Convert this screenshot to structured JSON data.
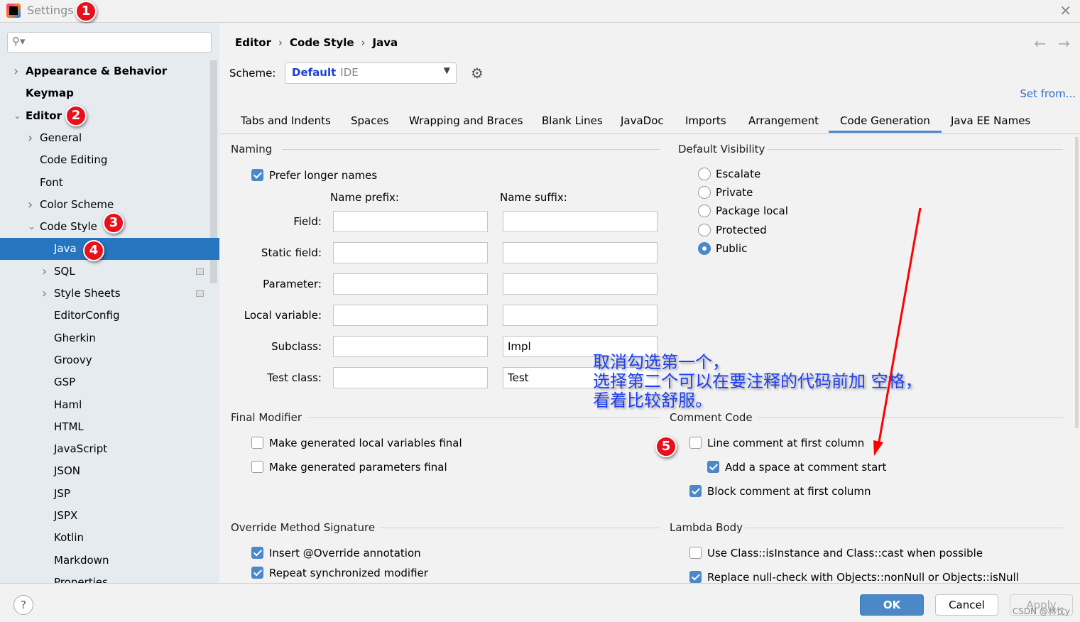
{
  "window": {
    "title": "Settings",
    "close_icon": "close-icon"
  },
  "annotations": {
    "b1": "1",
    "b2": "2",
    "b3": "3",
    "b4": "4",
    "b5": "5",
    "note": "取消勾选第一个，\n选择第二个可以在要注释的代码前加 空格，\n看着比较舒服。",
    "arrow_color": "#ff0000"
  },
  "sidebar": {
    "search_placeholder": "",
    "items": [
      {
        "label": "Appearance & Behavior"
      },
      {
        "label": "Keymap"
      },
      {
        "label": "Editor"
      },
      {
        "label": "General"
      },
      {
        "label": "Code Editing"
      },
      {
        "label": "Font"
      },
      {
        "label": "Color Scheme"
      },
      {
        "label": "Code Style"
      },
      {
        "label": "Java"
      },
      {
        "label": "SQL"
      },
      {
        "label": "Style Sheets"
      },
      {
        "label": "EditorConfig"
      },
      {
        "label": "Gherkin"
      },
      {
        "label": "Groovy"
      },
      {
        "label": "GSP"
      },
      {
        "label": "Haml"
      },
      {
        "label": "HTML"
      },
      {
        "label": "JavaScript"
      },
      {
        "label": "JSON"
      },
      {
        "label": "JSP"
      },
      {
        "label": "JSPX"
      },
      {
        "label": "Kotlin"
      },
      {
        "label": "Markdown"
      },
      {
        "label": "Properties"
      }
    ]
  },
  "breadcrumb": [
    "Editor",
    "Code Style",
    "Java"
  ],
  "scheme": {
    "label": "Scheme:",
    "value": "Default",
    "sub": "IDE",
    "set_from": "Set from..."
  },
  "tabs": [
    "Tabs and Indents",
    "Spaces",
    "Wrapping and Braces",
    "Blank Lines",
    "JavaDoc",
    "Imports",
    "Arrangement",
    "Code Generation",
    "Java EE Names"
  ],
  "active_tab": "Code Generation",
  "naming": {
    "title": "Naming",
    "prefer_longer": "Prefer longer names",
    "prefix_header": "Name prefix:",
    "suffix_header": "Name suffix:",
    "rows": [
      {
        "label": "Field:",
        "prefix": "",
        "suffix": ""
      },
      {
        "label": "Static field:",
        "prefix": "",
        "suffix": ""
      },
      {
        "label": "Parameter:",
        "prefix": "",
        "suffix": ""
      },
      {
        "label": "Local variable:",
        "prefix": "",
        "suffix": ""
      },
      {
        "label": "Subclass:",
        "prefix": "",
        "suffix": "Impl"
      },
      {
        "label": "Test class:",
        "prefix": "",
        "suffix": "Test"
      }
    ]
  },
  "visibility": {
    "title": "Default Visibility",
    "options": [
      "Escalate",
      "Private",
      "Package local",
      "Protected",
      "Public"
    ],
    "selected": "Public"
  },
  "final_modifier": {
    "title": "Final Modifier",
    "local": "Make generated local variables final",
    "params": "Make generated parameters final"
  },
  "comment_code": {
    "title": "Comment Code",
    "line_first": "Line comment at first column",
    "add_space": "Add a space at comment start",
    "block_first": "Block comment at first column"
  },
  "override": {
    "title": "Override Method Signature",
    "insert": "Insert @Override annotation",
    "repeat": "Repeat synchronized modifier"
  },
  "lambda": {
    "title": "Lambda Body",
    "use_class": "Use Class::isInstance and Class::cast when possible",
    "replace_null": "Replace null-check with Objects::nonNull or Objects::isNull"
  },
  "footer": {
    "help": "?",
    "ok": "OK",
    "cancel": "Cancel",
    "apply": "Apply",
    "watermark": "CSDN @林忱y"
  }
}
